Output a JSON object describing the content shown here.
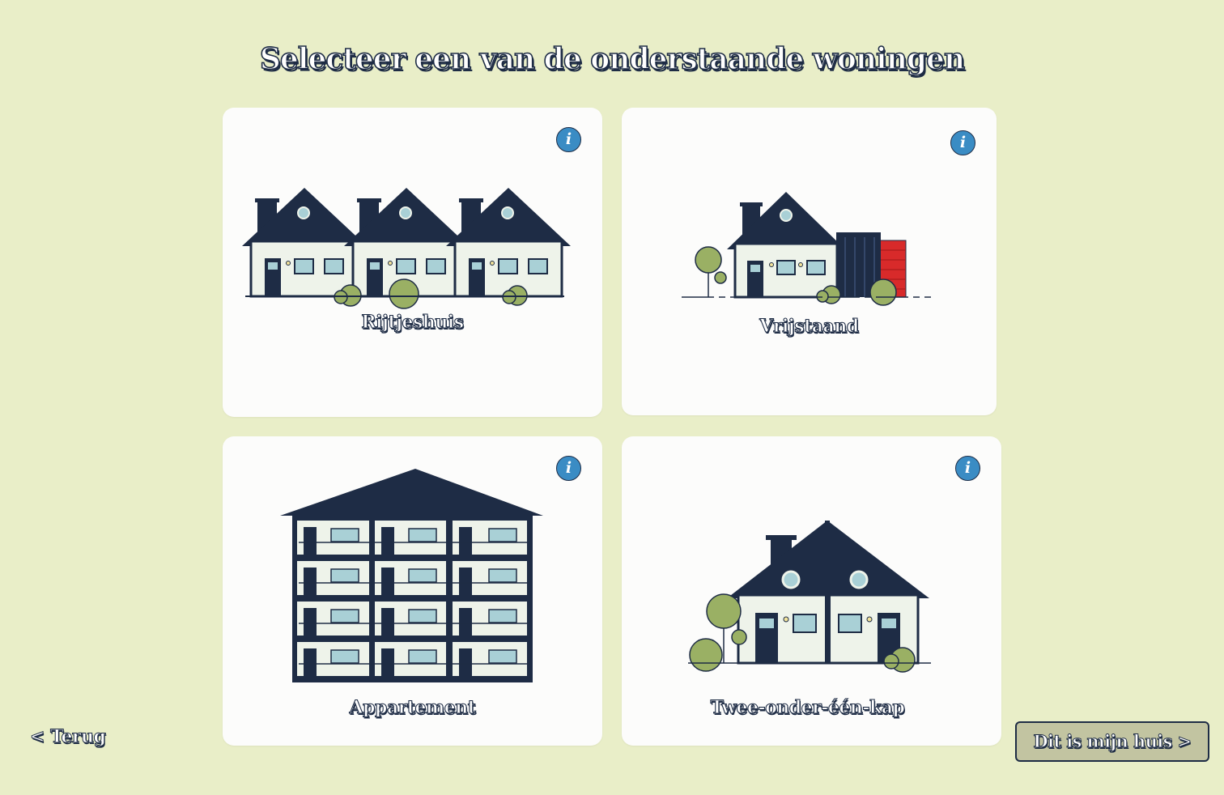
{
  "page": {
    "title": "Selecteer een van de onderstaande woningen"
  },
  "options": [
    {
      "label": "Rijtjeshuis",
      "info": "i"
    },
    {
      "label": "Vrijstaand",
      "info": "i"
    },
    {
      "label": "Appartement",
      "info": "i"
    },
    {
      "label": "Twee-onder-één-kap",
      "info": "i"
    }
  ],
  "nav": {
    "back_label": "< Terug",
    "confirm_label": "Dit is mijn  huis >"
  },
  "colors": {
    "background": "#e9eec8",
    "card": "#fcfcfb",
    "navy": "#1e2c45",
    "wall": "#eef3ea",
    "window": "#a9d0d6",
    "tree": "#9ab064",
    "brick": "#d82a2a",
    "info_button": "#3a8cc4",
    "confirm_button": "#c2c4a1"
  }
}
